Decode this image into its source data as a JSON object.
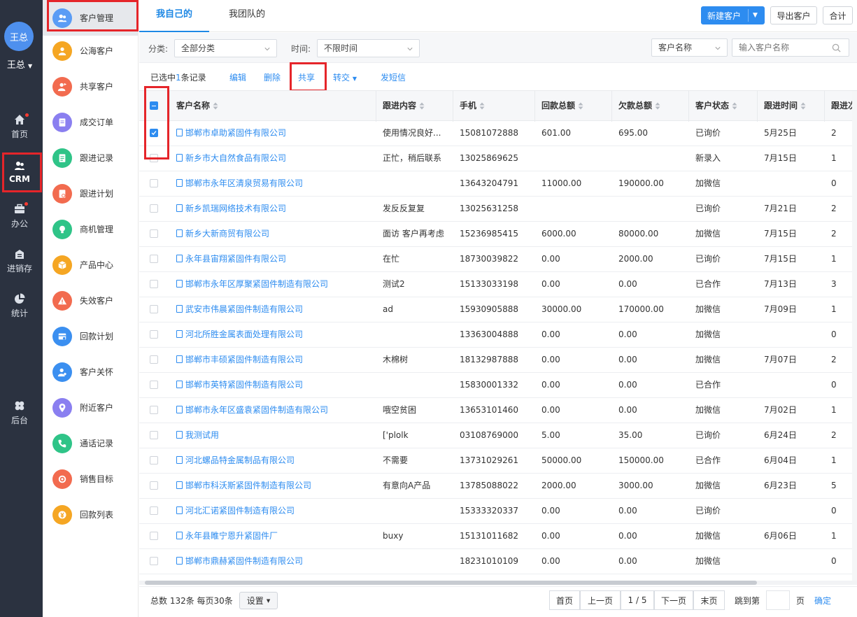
{
  "user": {
    "avatar_text": "王总",
    "name": "王总"
  },
  "rail": [
    {
      "label": "首页",
      "icon": "home-icon",
      "dot": true
    },
    {
      "label": "CRM",
      "icon": "crm-icon",
      "dot": false
    },
    {
      "label": "办公",
      "icon": "office-icon",
      "dot": true
    },
    {
      "label": "进销存",
      "icon": "inventory-icon",
      "dot": false
    },
    {
      "label": "统计",
      "icon": "pie-chart-icon",
      "dot": false
    },
    {
      "label": "后台",
      "icon": "clover-icon",
      "dot": false
    }
  ],
  "sidebar": {
    "items": [
      {
        "label": "客户管理",
        "icon": "customers-icon",
        "color": "#5a9cf5"
      },
      {
        "label": "公海客户",
        "icon": "person-icon",
        "color": "#f5a623"
      },
      {
        "label": "共享客户",
        "icon": "shared-person-icon",
        "color": "#f26b4f"
      },
      {
        "label": "成交订单",
        "icon": "order-icon",
        "color": "#8a7ff0"
      },
      {
        "label": "跟进记录",
        "icon": "note-icon",
        "color": "#2fc488"
      },
      {
        "label": "跟进计划",
        "icon": "plan-icon",
        "color": "#f26b4f"
      },
      {
        "label": "商机管理",
        "icon": "bulb-icon",
        "color": "#2fc488"
      },
      {
        "label": "产品中心",
        "icon": "box-icon",
        "color": "#f5a623"
      },
      {
        "label": "失效客户",
        "icon": "warning-icon",
        "color": "#f26b4f"
      },
      {
        "label": "回款计划",
        "icon": "payment-plan-icon",
        "color": "#3b8ff0"
      },
      {
        "label": "客户关怀",
        "icon": "care-icon",
        "color": "#3b8ff0"
      },
      {
        "label": "附近客户",
        "icon": "location-icon",
        "color": "#8a7ff0"
      },
      {
        "label": "通话记录",
        "icon": "phone-icon",
        "color": "#2fc488"
      },
      {
        "label": "销售目标",
        "icon": "target-icon",
        "color": "#f26b4f"
      },
      {
        "label": "回款列表",
        "icon": "money-icon",
        "color": "#f5a623"
      }
    ]
  },
  "tabs": [
    {
      "label": "我自己的"
    },
    {
      "label": "我团队的"
    }
  ],
  "toolbar": {
    "new_customer": "新建客户",
    "export": "导出客户",
    "merge": "合计"
  },
  "filters": {
    "category_label": "分类:",
    "category_value": "全部分类",
    "time_label": "时间:",
    "time_value": "不限时间",
    "search_field": "客户名称",
    "search_placeholder": "输入客户名称"
  },
  "actions": {
    "selected_prefix": "已选中",
    "selected_count": "1",
    "selected_suffix": "条记录",
    "edit": "编辑",
    "delete": "删除",
    "share": "共享",
    "transfer": "转交",
    "sms": "发短信"
  },
  "table": {
    "columns": [
      "客户名称",
      "跟进内容",
      "手机",
      "回款总额",
      "欠款总额",
      "客户状态",
      "跟进时间",
      "跟进次"
    ],
    "rows": [
      {
        "checked": true,
        "name": "邯郸市卓助紧固件有限公司",
        "followup": "使用情况良好...",
        "phone": "15081072888",
        "paid": "601.00",
        "owed": "695.00",
        "status": "已询价",
        "time": "5月25日",
        "count": "2"
      },
      {
        "checked": false,
        "name": "新乡市大自然食品有限公司",
        "followup": "正忙，稍后联系",
        "phone": "13025869625",
        "paid": "",
        "owed": "",
        "status": "新录入",
        "time": "7月15日",
        "count": "1"
      },
      {
        "checked": false,
        "name": "邯郸市永年区清泉贸易有限公司",
        "followup": "",
        "phone": "13643204791",
        "paid": "11000.00",
        "owed": "190000.00",
        "status": "加微信",
        "time": "",
        "count": "0"
      },
      {
        "checked": false,
        "name": "新乡凯瑞网络技术有限公司",
        "followup": "发反反复复",
        "phone": "13025631258",
        "paid": "",
        "owed": "",
        "status": "已询价",
        "time": "7月21日",
        "count": "2"
      },
      {
        "checked": false,
        "name": "新乡大新商贸有限公司",
        "followup": "面访 客户再考虑",
        "phone": "15236985415",
        "paid": "6000.00",
        "owed": "80000.00",
        "status": "加微信",
        "time": "7月15日",
        "count": "2"
      },
      {
        "checked": false,
        "name": "永年县宙翔紧固件有限公司",
        "followup": "在忙",
        "phone": "18730039822",
        "paid": "0.00",
        "owed": "2000.00",
        "status": "已询价",
        "time": "7月15日",
        "count": "1"
      },
      {
        "checked": false,
        "name": "邯郸市永年区厚聚紧固件制造有限公司",
        "followup": "测试2",
        "phone": "15133033198",
        "paid": "0.00",
        "owed": "0.00",
        "status": "已合作",
        "time": "7月13日",
        "count": "3"
      },
      {
        "checked": false,
        "name": "武安市伟晨紧固件制造有限公司",
        "followup": "ad",
        "phone": "15930905888",
        "paid": "30000.00",
        "owed": "170000.00",
        "status": "加微信",
        "time": "7月09日",
        "count": "1"
      },
      {
        "checked": false,
        "name": "河北所胜金属表面处理有限公司",
        "followup": "",
        "phone": "13363004888",
        "paid": "0.00",
        "owed": "0.00",
        "status": "加微信",
        "time": "",
        "count": "0"
      },
      {
        "checked": false,
        "name": "邯郸市丰硕紧固件制造有限公司",
        "followup": "木棉树",
        "phone": "18132987888",
        "paid": "0.00",
        "owed": "0.00",
        "status": "加微信",
        "time": "7月07日",
        "count": "2"
      },
      {
        "checked": false,
        "name": "邯郸市英特紧固件制造有限公司",
        "followup": "",
        "phone": "15830001332",
        "paid": "0.00",
        "owed": "0.00",
        "status": "已合作",
        "time": "",
        "count": "0"
      },
      {
        "checked": false,
        "name": "邯郸市永年区盛袁紧固件制造有限公司",
        "followup": "哦空贫困",
        "phone": "13653101460",
        "paid": "0.00",
        "owed": "0.00",
        "status": "加微信",
        "time": "7月02日",
        "count": "1"
      },
      {
        "checked": false,
        "name": "我测试用",
        "followup": "['plolk",
        "phone": "03108769000",
        "paid": "5.00",
        "owed": "35.00",
        "status": "已询价",
        "time": "6月24日",
        "count": "2"
      },
      {
        "checked": false,
        "name": "河北螺品特金属制品有限公司",
        "followup": "不需要",
        "phone": "13731029261",
        "paid": "50000.00",
        "owed": "150000.00",
        "status": "已合作",
        "time": "6月04日",
        "count": "1"
      },
      {
        "checked": false,
        "name": "邯郸市科沃斯紧固件制造有限公司",
        "followup": "有意向A产品",
        "phone": "13785088022",
        "paid": "2000.00",
        "owed": "3000.00",
        "status": "加微信",
        "time": "6月23日",
        "count": "5"
      },
      {
        "checked": false,
        "name": "河北汇诺紧固件制造有限公司",
        "followup": "",
        "phone": "15333320337",
        "paid": "0.00",
        "owed": "0.00",
        "status": "已询价",
        "time": "",
        "count": "0"
      },
      {
        "checked": false,
        "name": "永年县睢宁恩升紧固件厂",
        "followup": "buxy",
        "phone": "15131011682",
        "paid": "0.00",
        "owed": "0.00",
        "status": "加微信",
        "time": "6月06日",
        "count": "1"
      },
      {
        "checked": false,
        "name": "邯郸市鼎赫紧固件制造有限公司",
        "followup": "",
        "phone": "18231010109",
        "paid": "0.00",
        "owed": "0.00",
        "status": "加微信",
        "time": "",
        "count": "0"
      }
    ]
  },
  "footer": {
    "summary": "总数 132条 每页30条",
    "settings": "设置",
    "first": "首页",
    "prev": "上一页",
    "page": "1 / 5",
    "next": "下一页",
    "last": "末页",
    "jump_label": "跳到第",
    "page_unit": "页",
    "confirm": "确定"
  },
  "colors": {
    "accent": "#2d8cf0",
    "rail": "#2b3240",
    "highlight": "#e5252a"
  }
}
